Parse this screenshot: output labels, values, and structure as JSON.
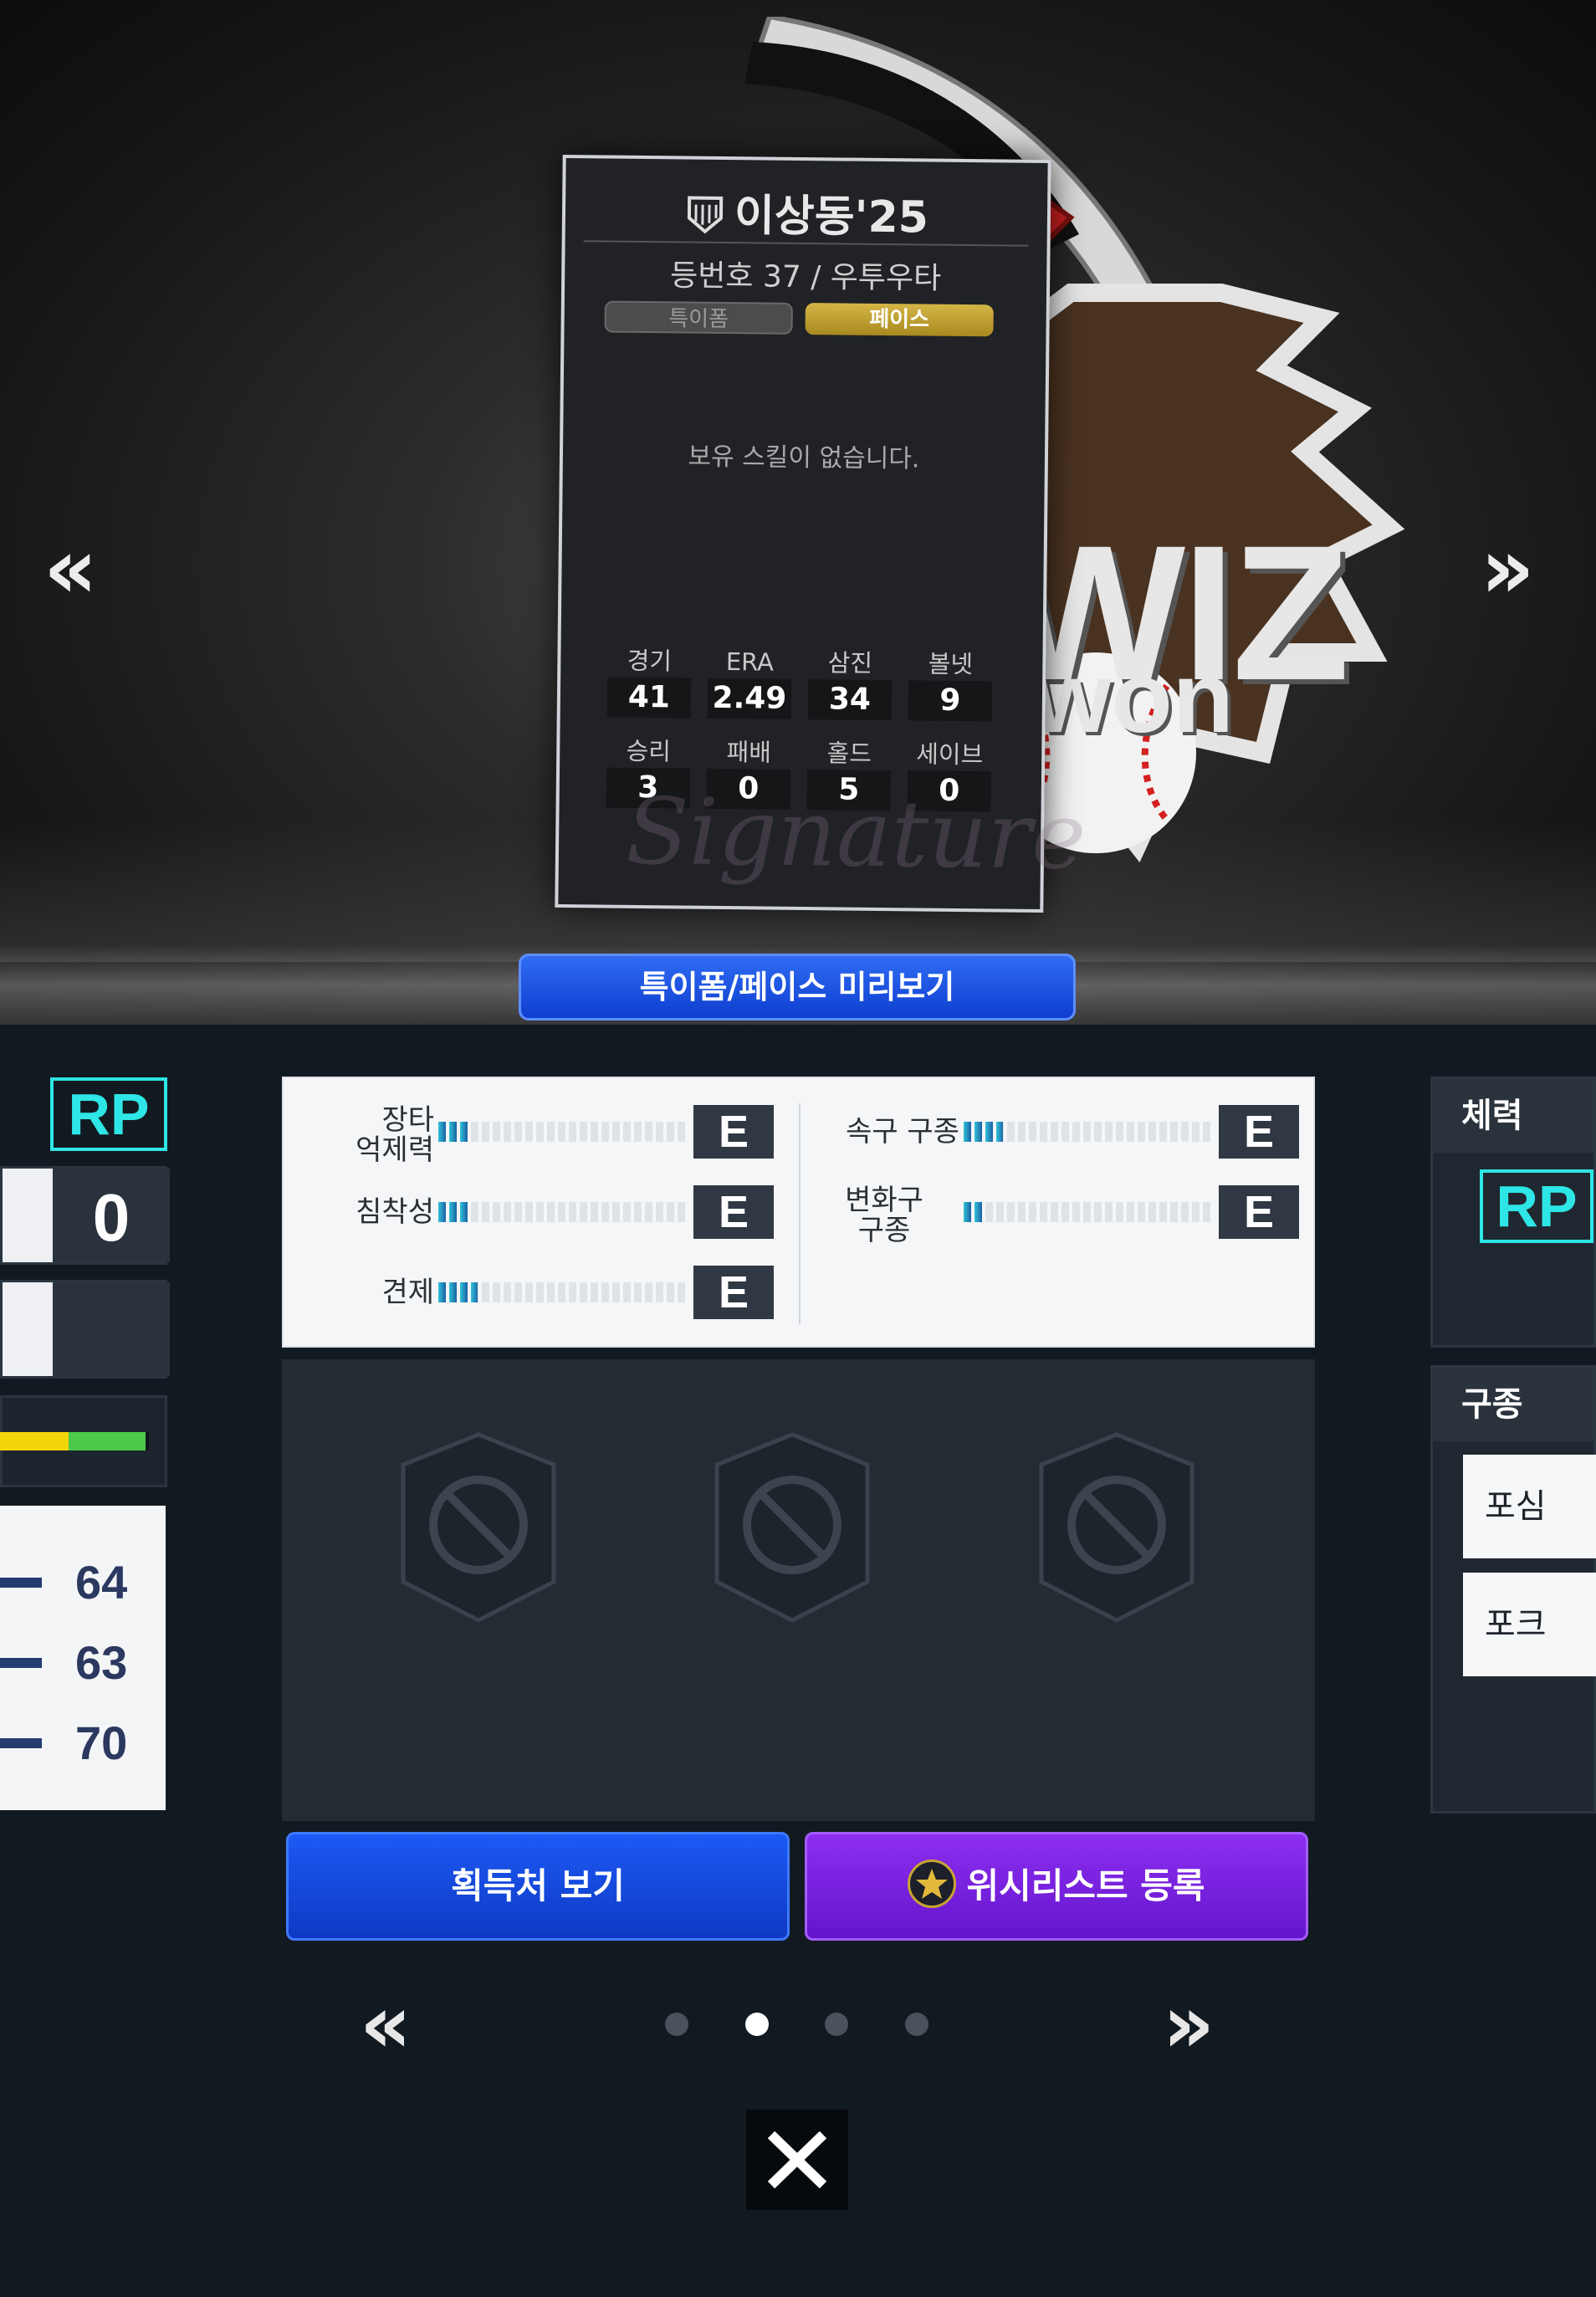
{
  "card": {
    "player_name": "이상동'25",
    "subtitle": "등번호 37 / 우투우타",
    "tabs": [
      {
        "label": "특이폼",
        "active": false
      },
      {
        "label": "페이스",
        "active": true
      }
    ],
    "empty_message": "보유 스킬이 없습니다.",
    "stats_row1": [
      {
        "label": "경기",
        "value": "41"
      },
      {
        "label": "ERA",
        "value": "2.49"
      },
      {
        "label": "삼진",
        "value": "34"
      },
      {
        "label": "볼넷",
        "value": "9"
      }
    ],
    "stats_row2": [
      {
        "label": "승리",
        "value": "3"
      },
      {
        "label": "패배",
        "value": "0"
      },
      {
        "label": "홀드",
        "value": "5"
      },
      {
        "label": "세이브",
        "value": "0"
      }
    ],
    "watermark": "Signature"
  },
  "team_logo": {
    "line1": "WIZ",
    "line2": "won"
  },
  "preview_button": "특이폼/페이스 미리보기",
  "left_panel": {
    "position": "RP",
    "value_row": "0",
    "list_values": [
      "64",
      "63",
      "70"
    ]
  },
  "skills_left": [
    {
      "label": "장타\n억제력",
      "grade": "E",
      "fill": 0.12
    },
    {
      "label": "침착성",
      "grade": "E",
      "fill": 0.12
    },
    {
      "label": "견제",
      "grade": "E",
      "fill": 0.16
    }
  ],
  "skills_right": [
    {
      "label": "속구 구종",
      "grade": "E",
      "fill": 0.16
    },
    {
      "label": "변화구\n구종",
      "grade": "E",
      "fill": 0.08
    }
  ],
  "buttons": {
    "acquire": "획득처 보기",
    "wishlist": "위시리스트 등록"
  },
  "pager": {
    "pages": 4,
    "active": 1
  },
  "right_panel": {
    "stamina_title": "체력",
    "position": "RP",
    "pitch_title": "구종",
    "pitches": [
      "포심",
      "포크"
    ]
  },
  "colors": {
    "accent_cyan": "#2ee6e6",
    "button_blue": "#1c5af5",
    "button_purple": "#8d2ef0",
    "tab_gold": "#c9a533"
  }
}
